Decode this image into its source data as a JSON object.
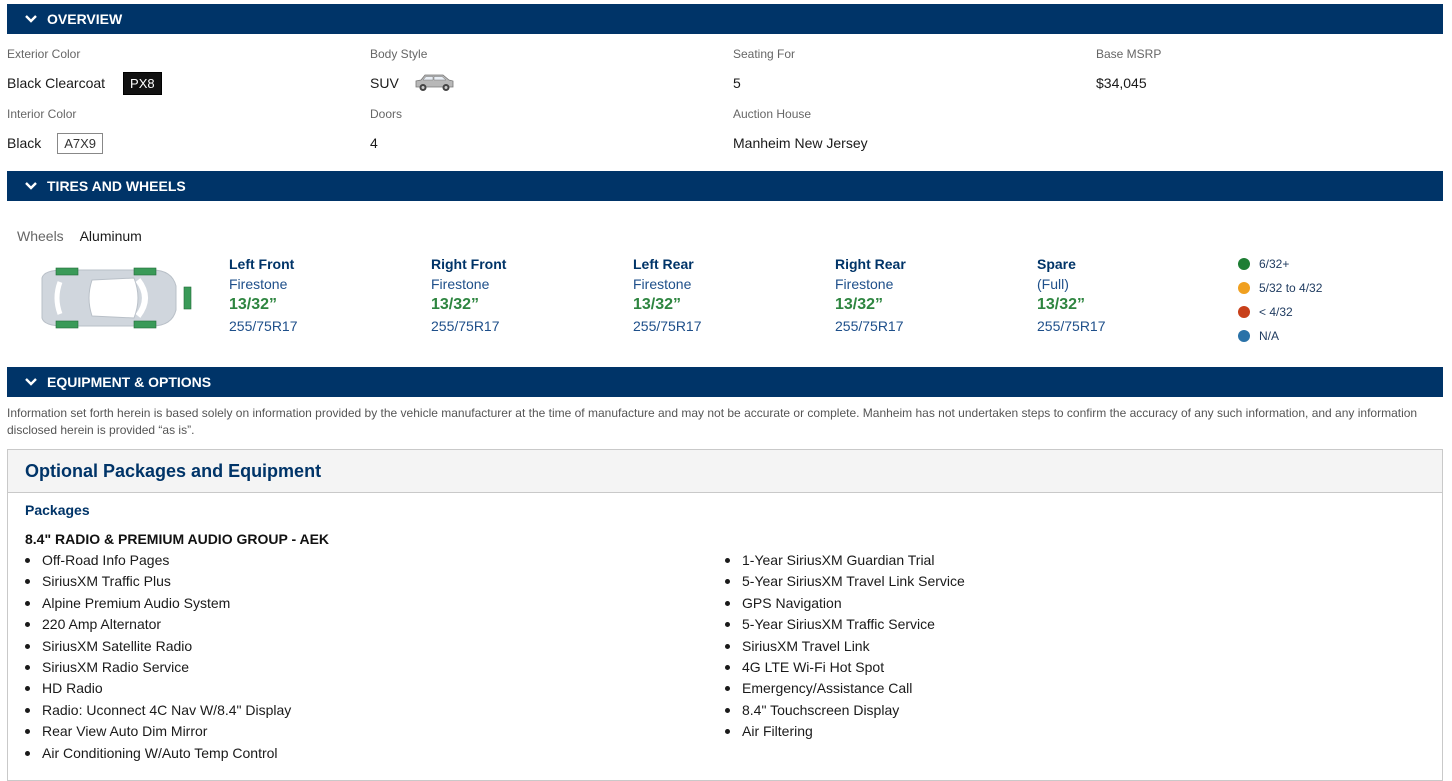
{
  "overview": {
    "header": "OVERVIEW",
    "exterior_color_label": "Exterior Color",
    "exterior_color": "Black Clearcoat",
    "exterior_code": "PX8",
    "body_style_label": "Body Style",
    "body_style": "SUV",
    "seating_label": "Seating For",
    "seating": "5",
    "msrp_label": "Base MSRP",
    "msrp": "$34,045",
    "interior_color_label": "Interior Color",
    "interior_color": "Black",
    "interior_code": "A7X9",
    "doors_label": "Doors",
    "doors": "4",
    "auction_label": "Auction House",
    "auction": "Manheim New Jersey"
  },
  "tires": {
    "header": "TIRES AND WHEELS",
    "wheels_label": "Wheels",
    "wheels_value": "Aluminum",
    "items": [
      {
        "position": "Left Front",
        "brand": "Firestone",
        "depth": "13/32”",
        "size": "255/75R17"
      },
      {
        "position": "Right Front",
        "brand": "Firestone",
        "depth": "13/32”",
        "size": "255/75R17"
      },
      {
        "position": "Left Rear",
        "brand": "Firestone",
        "depth": "13/32”",
        "size": "255/75R17"
      },
      {
        "position": "Right Rear",
        "brand": "Firestone",
        "depth": "13/32”",
        "size": "255/75R17"
      },
      {
        "position": "Spare",
        "brand": "(Full)",
        "depth": "13/32”",
        "size": "255/75R17"
      }
    ],
    "legend": [
      {
        "label": "6/32+",
        "color": "#1e7e34"
      },
      {
        "label": "5/32 to 4/32",
        "color": "#f0a020"
      },
      {
        "label": "< 4/32",
        "color": "#c8401a"
      },
      {
        "label": "N/A",
        "color": "#2a72a8"
      }
    ]
  },
  "equipment": {
    "header": "EQUIPMENT & OPTIONS",
    "disclaimer": "Information set forth herein is based solely on information provided by the vehicle manufacturer at the time of manufacture and may not be accurate or complete. Manheim has not undertaken steps to confirm the accuracy of any such information, and any information disclosed herein is provided “as is”.",
    "panel_title": "Optional Packages and Equipment",
    "packages_label": "Packages",
    "group_title": "8.4\" RADIO & PREMIUM AUDIO GROUP - AEK",
    "left_items": [
      "Off-Road Info Pages",
      "SiriusXM Traffic Plus",
      "Alpine Premium Audio System",
      "220 Amp Alternator",
      "SiriusXM Satellite Radio",
      "SiriusXM Radio Service",
      "HD Radio",
      "Radio: Uconnect 4C Nav W/8.4\" Display",
      "Rear View Auto Dim Mirror",
      "Air Conditioning W/Auto Temp Control"
    ],
    "right_items": [
      "1-Year SiriusXM Guardian Trial",
      "5-Year SiriusXM Travel Link Service",
      "GPS Navigation",
      "5-Year SiriusXM Traffic Service",
      "SiriusXM Travel Link",
      "4G LTE Wi-Fi Hot Spot",
      "Emergency/Assistance Call",
      "8.4\" Touchscreen Display",
      "Air Filtering"
    ]
  }
}
